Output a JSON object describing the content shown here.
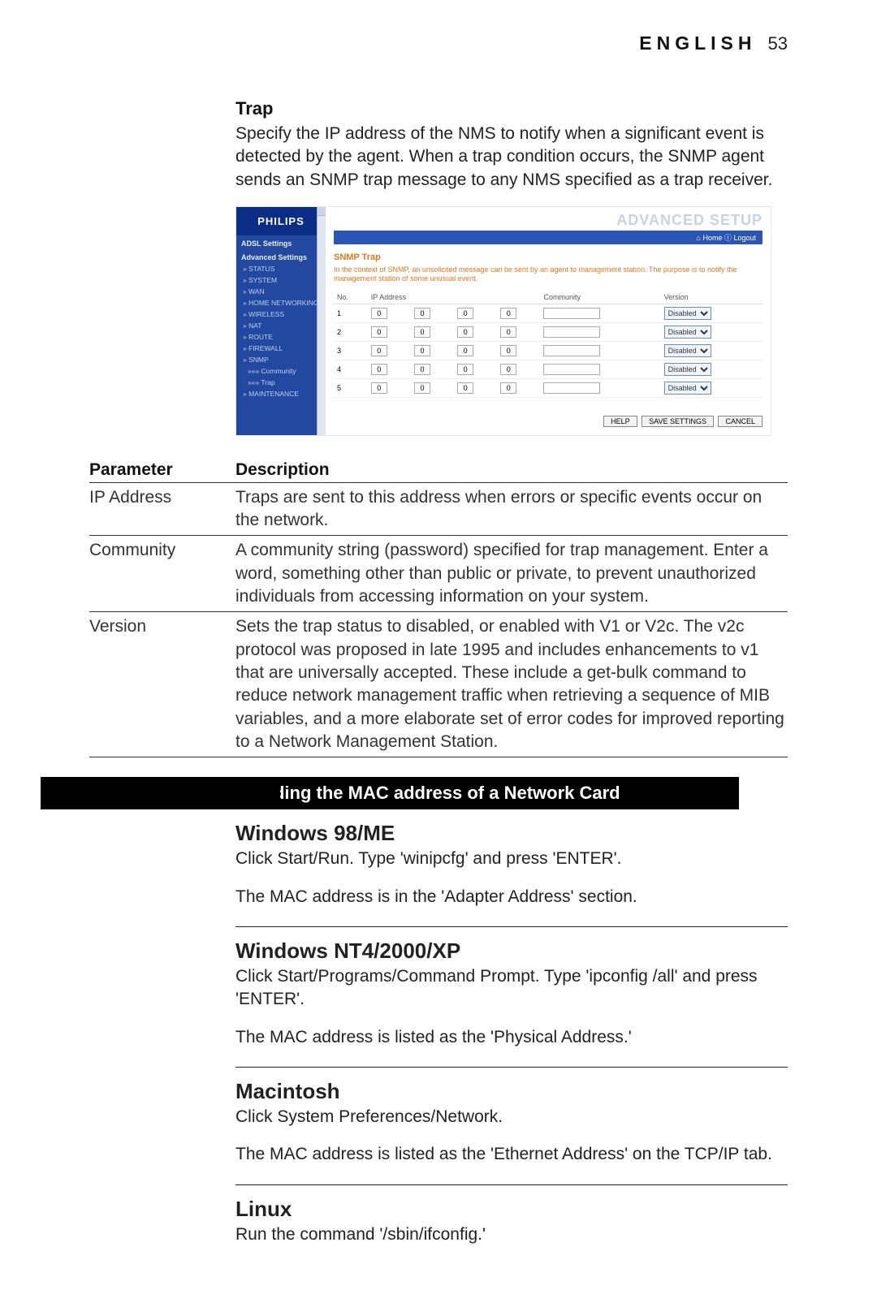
{
  "header": {
    "language": "ENGLISH",
    "page_number": "53"
  },
  "trap": {
    "title": "Trap",
    "body": "Specify the IP address of the NMS to notify when a significant event is detected by the agent. When a trap condition occurs, the SNMP agent sends an SNMP trap message to any NMS specified as a trap receiver."
  },
  "router": {
    "brand": "PHILIPS",
    "sidebar": {
      "section1": "ADSL Settings",
      "section2": "Advanced Settings",
      "items": [
        "» STATUS",
        "» SYSTEM",
        "» WAN",
        "» HOME NETWORKING",
        "» WIRELESS",
        "» NAT",
        "» ROUTE",
        "» FIREWALL",
        "» SNMP"
      ],
      "subitems": [
        "»»» Community",
        "»»» Trap"
      ],
      "maintenance": "» MAINTENANCE"
    },
    "main_title": "ADVANCED SETUP",
    "bar": "⌂ Home  ⓘ Logout",
    "snmp_heading": "SNMP Trap",
    "snmp_desc": "In the context of SNMP, an unsolicited message can be sent by an agent to management station. The purpose is to notify the management station of some unusual event.",
    "columns": {
      "no": "No.",
      "ip": "IP Address",
      "community": "Community",
      "version": "Version"
    },
    "rows": [
      {
        "no": "1",
        "ip": [
          "0",
          "0",
          "0",
          "0"
        ],
        "community": "",
        "version": "Disabled"
      },
      {
        "no": "2",
        "ip": [
          "0",
          "0",
          "0",
          "0"
        ],
        "community": "",
        "version": "Disabled"
      },
      {
        "no": "3",
        "ip": [
          "0",
          "0",
          "0",
          "0"
        ],
        "community": "",
        "version": "Disabled"
      },
      {
        "no": "4",
        "ip": [
          "0",
          "0",
          "0",
          "0"
        ],
        "community": "",
        "version": "Disabled"
      },
      {
        "no": "5",
        "ip": [
          "0",
          "0",
          "0",
          "0"
        ],
        "community": "",
        "version": "Disabled"
      }
    ],
    "buttons": {
      "help": "HELP",
      "save": "SAVE SETTINGS",
      "cancel": "CANCEL"
    }
  },
  "param_table": {
    "headers": {
      "param": "Parameter",
      "desc": "Description"
    },
    "rows": [
      {
        "param": "IP Address",
        "desc": "Traps are sent to this address when errors or specific events occur on the network."
      },
      {
        "param": "Community",
        "desc": "A community string (password) specified for trap management. Enter a word, something other than public or private, to prevent unauthorized individuals from accessing information on your system."
      },
      {
        "param": "Version",
        "desc": "Sets the trap status to disabled, or enabled with V1 or V2c. The v2c protocol was proposed in late 1995 and includes enhancements to v1 that are universally accepted. These include a get-bulk command to reduce network management traffic when retrieving a sequence of MIB variables, and a more elaborate set of error codes for improved reporting to a Network Management Station."
      }
    ]
  },
  "black_bar": "Finding the MAC address of a Network Card",
  "os": {
    "win98_title": "Windows 98/ME",
    "win98_1": "Click Start/Run. Type 'winipcfg' and press 'ENTER'.",
    "win98_2": "The MAC address is in the 'Adapter Address' section.",
    "winnt_title": "Windows NT4/2000/XP",
    "winnt_1": "Click Start/Programs/Command Prompt. Type 'ipconfig /all' and press 'ENTER'.",
    "winnt_2": "The MAC address is listed as the 'Physical Address.'",
    "mac_title": "Macintosh",
    "mac_1": "Click System Preferences/Network.",
    "mac_2": "The MAC address is listed as the 'Ethernet Address' on the TCP/IP tab.",
    "linux_title": "Linux",
    "linux_1": "Run the command '/sbin/ifconfig.'"
  }
}
